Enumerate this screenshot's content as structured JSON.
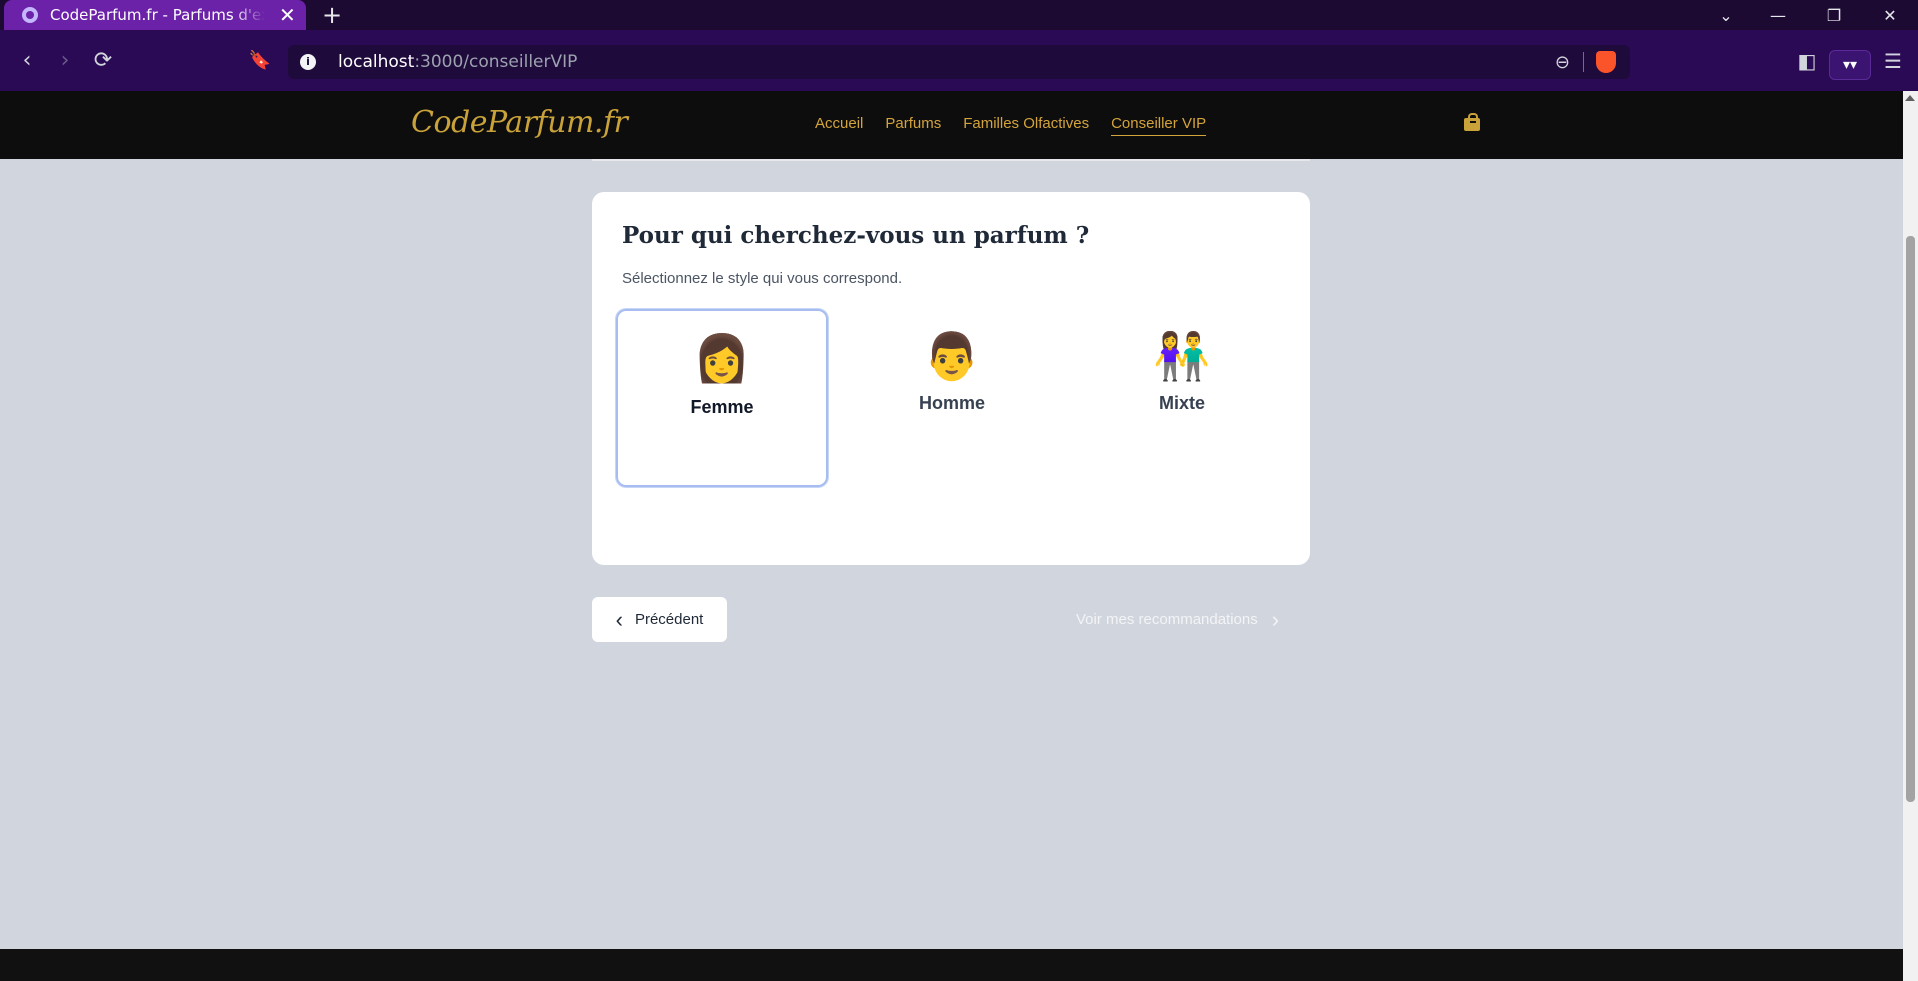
{
  "browser": {
    "tab_title": "CodeParfum.fr - Parfums d'exceptions",
    "url_host": "localhost",
    "url_path": ":3000/conseillerVIP"
  },
  "site": {
    "logo": "CodeParfum.fr",
    "nav": [
      "Accueil",
      "Parfums",
      "Familles Olfactives",
      "Conseiller VIP"
    ],
    "active_nav": "Conseiller VIP"
  },
  "quiz": {
    "title": "Pour qui cherchez-vous un parfum ?",
    "subtitle": "Sélectionnez le style qui vous correspond.",
    "options": [
      {
        "emoji": "👩",
        "label": "Femme",
        "selected": true
      },
      {
        "emoji": "👨",
        "label": "Homme",
        "selected": false
      },
      {
        "emoji": "👫",
        "label": "Mixte",
        "selected": false
      }
    ],
    "prev_label": "Précédent",
    "next_label": "Voir mes recommandations"
  },
  "icons": {
    "chevron_left": "‹",
    "chevron_right": "›"
  }
}
